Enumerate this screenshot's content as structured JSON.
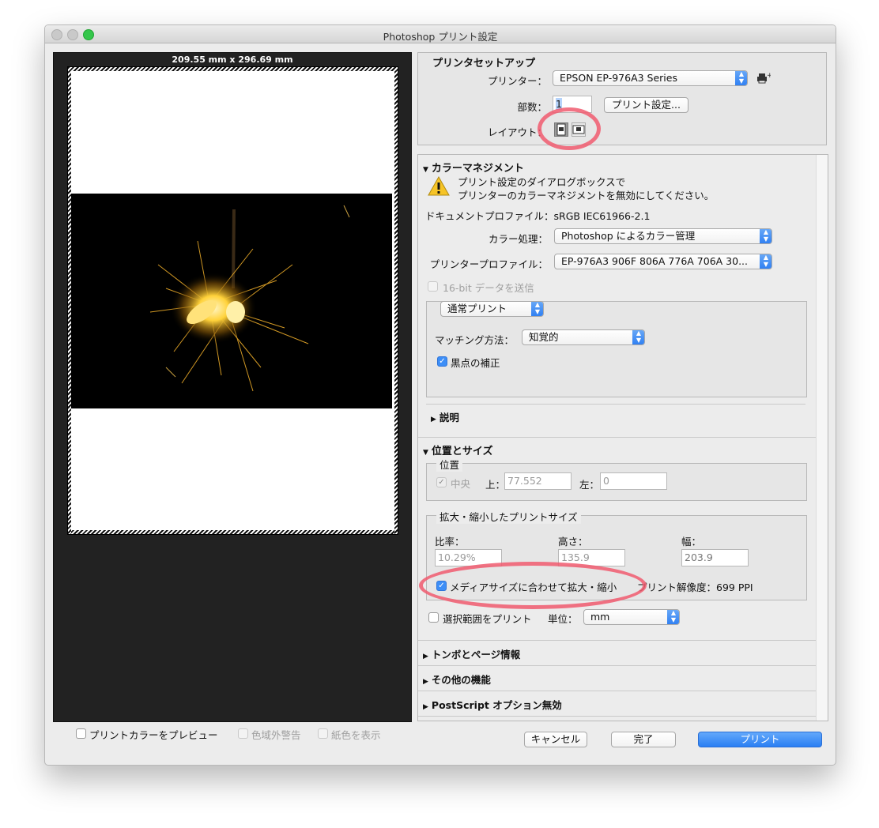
{
  "window": {
    "title": "Photoshop プリント設定",
    "paper_size_label": "209.55 mm x 296.69 mm"
  },
  "printer_setup": {
    "heading": "プリンタセットアップ",
    "printer_label": "プリンター：",
    "printer_value": "EPSON EP-976A3 Series",
    "copies_label": "部数：",
    "copies_value": "1",
    "print_settings_button": "プリント設定...",
    "layout_label": "レイアウト："
  },
  "color_management": {
    "heading": "カラーマネジメント",
    "warning_line1": "プリント設定のダイアログボックスで",
    "warning_line2": "プリンターのカラーマネジメントを無効にしてください。",
    "document_profile": "ドキュメントプロファイル：sRGB IEC61966-2.1",
    "color_handling_label": "カラー処理：",
    "color_handling_value": "Photoshop によるカラー管理",
    "printer_profile_label": "プリンタープロファイル：",
    "printer_profile_value": "EP-976A3 906F 806A 776A 706A 30...",
    "send_16bit_label": "16-bit データを送信",
    "normal_print_value": "通常プリント",
    "matching_label": "マッチング方法：",
    "matching_value": "知覚的",
    "black_point_label": "黒点の補正",
    "description_heading": "説明"
  },
  "position_size": {
    "heading": "位置とサイズ",
    "position_group_label": "位置",
    "center_label": "中央",
    "top_label": "上：",
    "top_value": "77.552",
    "left_label": "左：",
    "left_value": "0",
    "scaled_group_label": "拡大・縮小したプリントサイズ",
    "scale_label": "比率：",
    "scale_value": "10.29%",
    "height_label": "高さ：",
    "height_value": "135.9",
    "width_label": "幅：",
    "width_value": "203.9",
    "fit_media_label": "メディアサイズに合わせて拡大・縮小",
    "print_resolution": "プリント解像度：699 PPI",
    "print_selection_label": "選択範囲をプリント",
    "unit_label": "単位：",
    "unit_value": "mm"
  },
  "sections": {
    "marks": "トンボとページ情報",
    "other": "その他の機能",
    "postscript": "PostScript オプション無効"
  },
  "footer": {
    "preview_color_label": "プリントカラーをプレビュー",
    "gamut_warning_label": "色域外警告",
    "show_paper_label": "紙色を表示",
    "cancel_button": "キャンセル",
    "done_button": "完了",
    "print_button": "プリント"
  },
  "colors": {
    "accent": "#2a7ff3",
    "annotation_red": "#f05a6e"
  }
}
